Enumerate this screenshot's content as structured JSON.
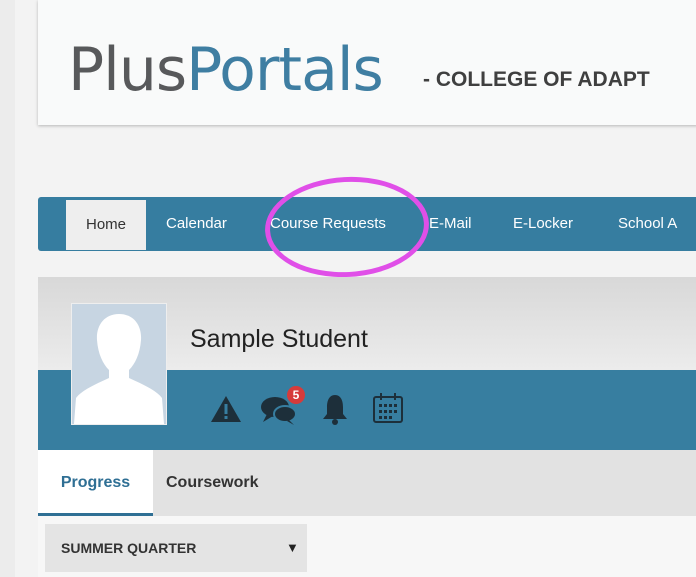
{
  "header": {
    "logo_part1": "Plus",
    "logo_part2": "Portals",
    "school_name": "- COLLEGE OF ADAPT"
  },
  "nav": {
    "items": [
      {
        "label": "Home"
      },
      {
        "label": "Calendar"
      },
      {
        "label": "Course Requests"
      },
      {
        "label": "E-Mail"
      },
      {
        "label": "E-Locker"
      },
      {
        "label": "School A"
      }
    ],
    "active_index": 0
  },
  "annotation": {
    "color": "#e04fe8",
    "target": "Course Requests"
  },
  "student": {
    "name": "Sample Student",
    "message_count": "5"
  },
  "icons": [
    "alert-icon",
    "chat-icon",
    "bell-icon",
    "calendar-icon"
  ],
  "tabs": [
    {
      "label": "Progress",
      "active": true
    },
    {
      "label": "Coursework",
      "active": false
    }
  ],
  "term_select": {
    "value": "SUMMER QUARTER"
  },
  "colors": {
    "brand_blue": "#367da0",
    "logo_gray": "#58595b",
    "logo_blue": "#3f7ea2",
    "badge_red": "#d63b3b"
  }
}
